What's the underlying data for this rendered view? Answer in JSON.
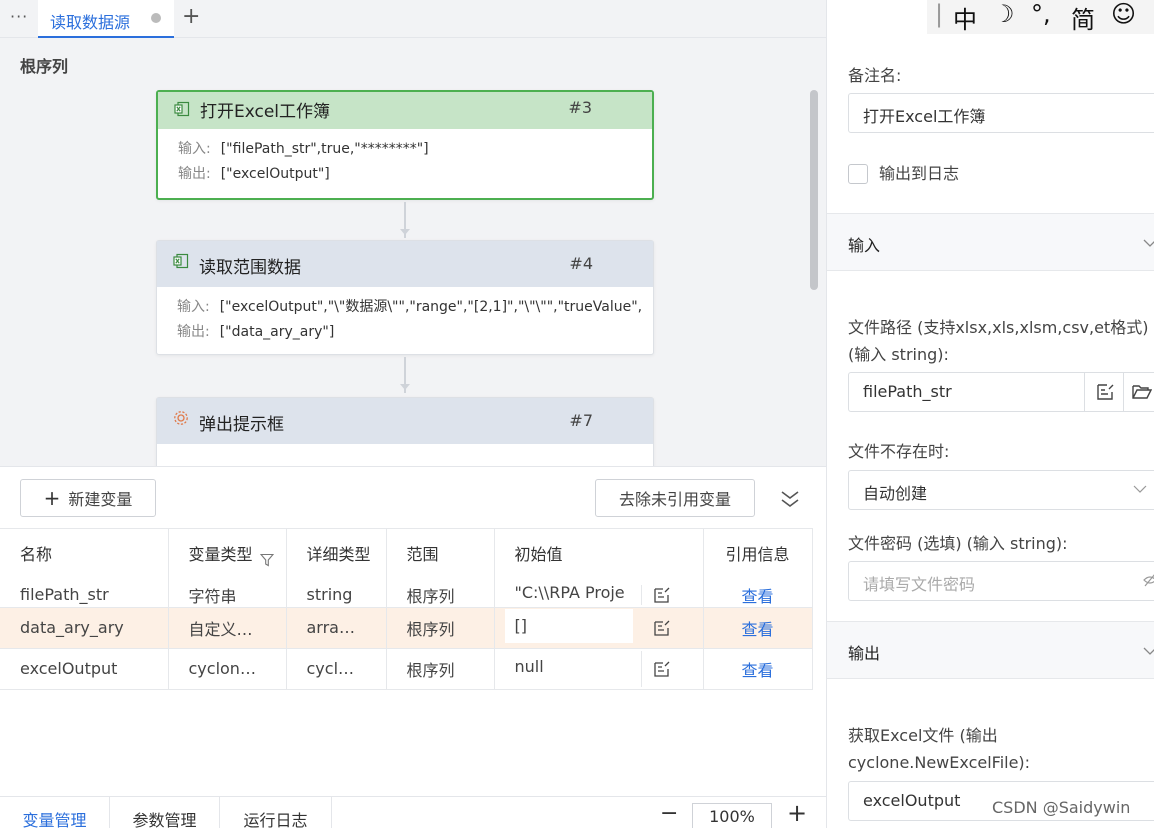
{
  "tabbar": {
    "more_label": "···",
    "tab_label": "读取数据源",
    "add_label": "+"
  },
  "canvas": {
    "root_label": "根序列",
    "nodes": [
      {
        "title": "打开Excel工作簿",
        "id": "#3",
        "input_key": "输入:",
        "input": "[\"filePath_str\",true,\"********\"]",
        "output_key": "输出:",
        "output": "[\"excelOutput\"]",
        "icon": "excel-icon",
        "active": true
      },
      {
        "title": "读取范围数据",
        "id": "#4",
        "input_key": "输入:",
        "input": "[\"excelOutput\",\"\\\"数据源\\\"\",\"range\",\"[2,1]\",\"\\\"\\\"\",\"trueValue\",",
        "output_key": "输出:",
        "output": "[\"data_ary_ary\"]",
        "icon": "excel-icon",
        "active": false
      },
      {
        "title": "弹出提示框",
        "id": "#7",
        "icon": "gear-icon",
        "active": false
      }
    ]
  },
  "variables": {
    "new_button": "新建变量",
    "remove_button": "去除未引用变量",
    "columns": [
      "名称",
      "变量类型",
      "详细类型",
      "范围",
      "初始值",
      "引用信息"
    ],
    "rows": [
      {
        "name": "filePath_str",
        "type": "字符串",
        "detail": "string",
        "scope": "根序列",
        "value": "\"C:\\\\RPA Proje",
        "link": "查看"
      },
      {
        "name": "data_ary_ary",
        "type": "自定义…",
        "detail": "arra…",
        "scope": "根序列",
        "value": "[]",
        "link": "查看"
      },
      {
        "name": "excelOutput",
        "type": "cyclon…",
        "detail": "cycl…",
        "scope": "根序列",
        "value": "null",
        "link": "查看"
      }
    ]
  },
  "bottom": {
    "tabs": [
      "变量管理",
      "参数管理",
      "运行日志"
    ],
    "zoom_minus": "−",
    "zoom": "100%",
    "zoom_plus": "+"
  },
  "right": {
    "ime": [
      "中",
      "☽",
      "°,",
      "简",
      "☺"
    ],
    "note_label": "备注名:",
    "note_value": "打开Excel工作簿",
    "log_label": "输出到日志",
    "input_section": "输入",
    "path_label_1": "文件路径 (支持xlsx,xls,xlsm,csv,et格式)",
    "path_label_2": "(输入 string):",
    "path_value": "filePath_str",
    "missing_label": "文件不存在时:",
    "missing_value": "自动创建",
    "password_label": "文件密码 (选填) (输入 string):",
    "password_placeholder": "请填写文件密码",
    "output_section": "输出",
    "output_label_1": "获取Excel文件 (输出",
    "output_label_2": "cyclone.NewExcelFile):",
    "output_value": "excelOutput"
  },
  "watermark": "CSDN @Saidywin",
  "colors": {
    "accent": "#2b6fdc",
    "active_node_border": "#4caf50",
    "active_node_header": "#c6e4c7",
    "node_header": "#dde3ec",
    "row_highlight": "#fdf0e5"
  }
}
